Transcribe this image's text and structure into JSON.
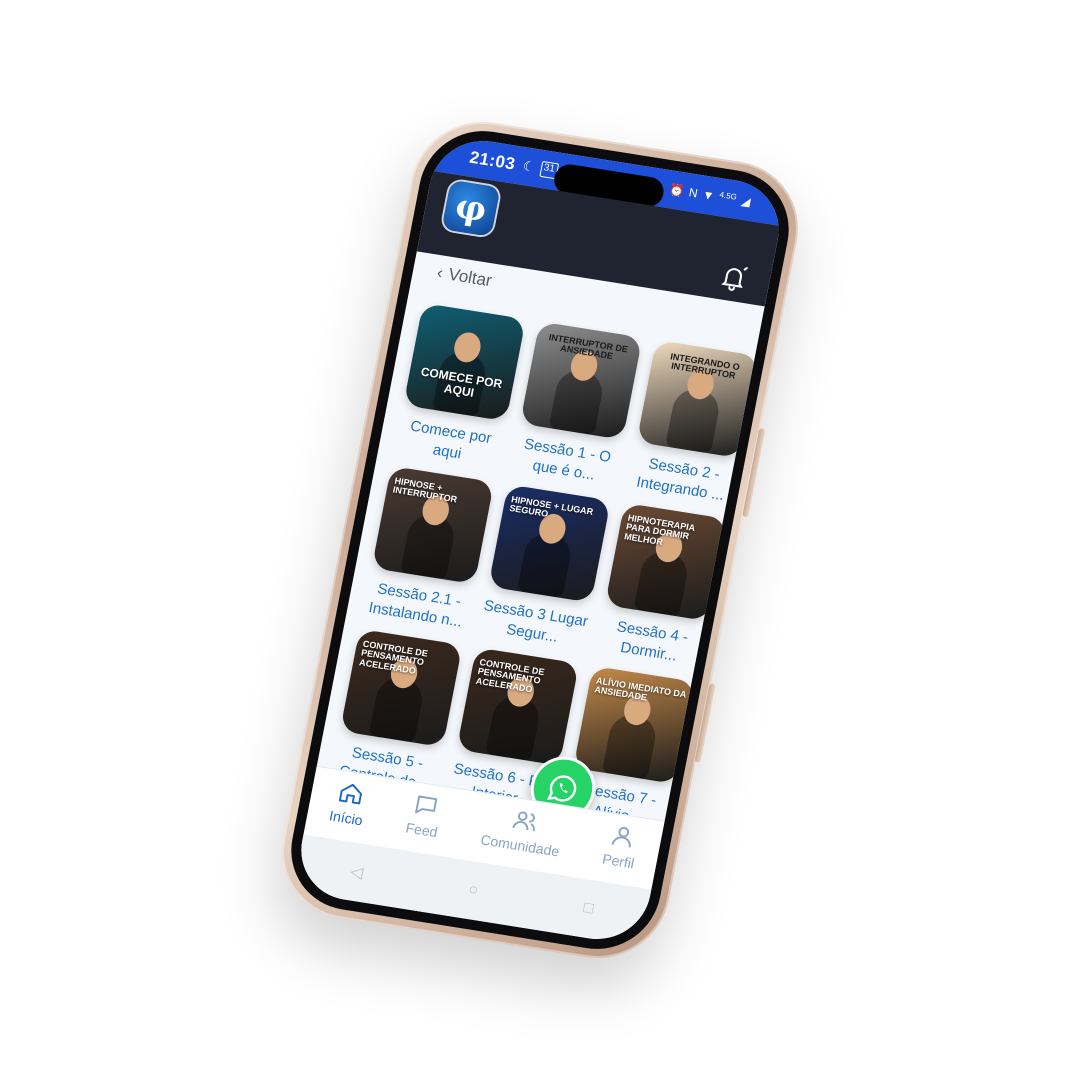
{
  "status_bar": {
    "time": "21:03",
    "left_icons": [
      "moon-icon",
      "calendar-icon",
      "youtube-icon"
    ],
    "right_icons": [
      "alarm-icon",
      "nfc-icon",
      "wifi-icon",
      "4g-icon",
      "signal-icon"
    ],
    "calendar_day": "31",
    "network": "4.5G"
  },
  "app_bar": {
    "logo_glyph": "φ",
    "bell_icon": "bell-icon"
  },
  "back": {
    "label": "Voltar"
  },
  "sessions": [
    {
      "title": "Comece por aqui",
      "thumb_text": "COMECE POR AQUI",
      "bg": "#0f5f73"
    },
    {
      "title": "Sessão 1 - O que é o...",
      "thumb_text": "INTERRUPTOR DE ANSIEDADE",
      "bg": "#8f8f8f"
    },
    {
      "title": "Sessão 2 - Integrando ...",
      "thumb_text": "INTEGRANDO O INTERRUPTOR",
      "bg": "#f1dcc0"
    },
    {
      "title": "Sessão 2.1 - Instalando n...",
      "thumb_text": "HIPNOSE + INTERRUPTOR",
      "bg": "#4a3b32"
    },
    {
      "title": "Sessão 3 Lugar Segur...",
      "thumb_text": "HIPNOSE + LUGAR SEGURO",
      "bg": "#1a2d66"
    },
    {
      "title": "Sessão 4 - Dormir...",
      "thumb_text": "Hipnoterapia para Dormir Melhor",
      "bg": "#6b4a35"
    },
    {
      "title": "Sessão 5 - Controle de...",
      "thumb_text": "CONTROLE DE PENSAMENTO ACELERADO",
      "bg": "#3d2a1e"
    },
    {
      "title": "Sessão 6 - Paz Interior...",
      "thumb_text": "CONTROLE DE PENSAMENTO ACELERADO",
      "bg": "#3a281c"
    },
    {
      "title": "Sessão 7 - Alívio...",
      "thumb_text": "ALÍVIO IMEDIATO DA ANSIEDADE",
      "bg": "#c48a4a"
    }
  ],
  "bottom_nav": [
    {
      "label": "Início",
      "icon": "home-icon",
      "active": true
    },
    {
      "label": "Feed",
      "icon": "chat-icon",
      "active": false
    },
    {
      "label": "Comunidade",
      "icon": "users-icon",
      "active": false
    },
    {
      "label": "Perfil",
      "icon": "user-icon",
      "active": false
    }
  ],
  "fab": {
    "icon": "whatsapp-icon"
  },
  "colors": {
    "status_bar": "#1d4fd8",
    "app_bar": "#1f2430",
    "label_blue": "#2272c3",
    "nav_active": "#1f66c1",
    "whatsapp": "#25d366"
  }
}
